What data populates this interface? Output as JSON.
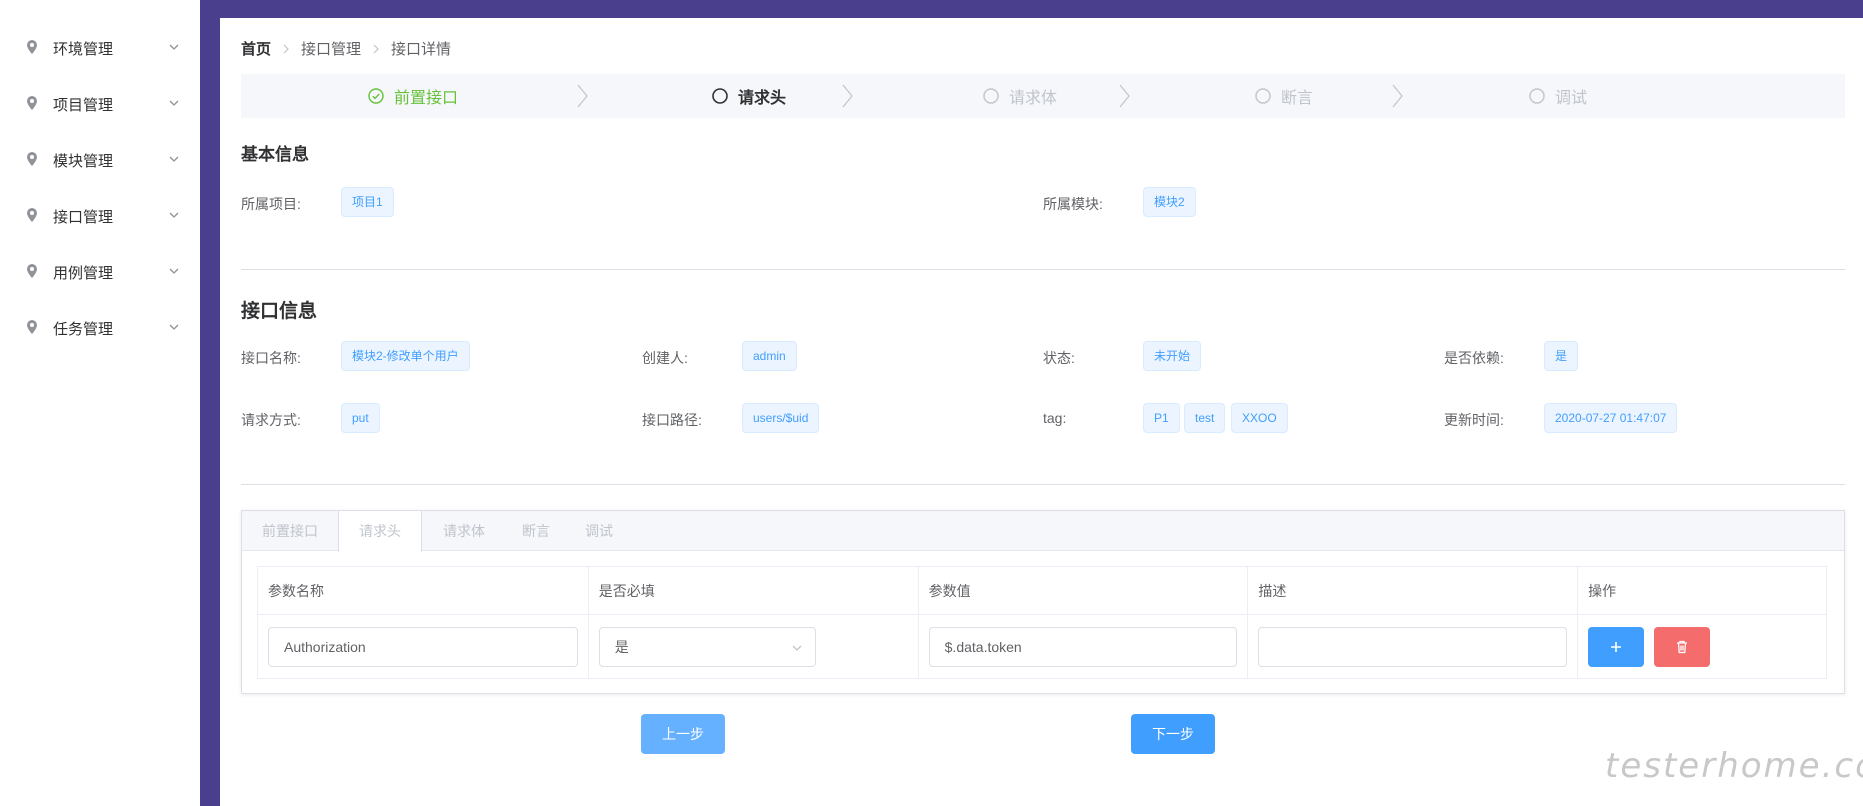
{
  "sidebar": {
    "items": [
      {
        "label": "环境管理"
      },
      {
        "label": "项目管理"
      },
      {
        "label": "模块管理"
      },
      {
        "label": "接口管理"
      },
      {
        "label": "用例管理"
      },
      {
        "label": "任务管理"
      }
    ]
  },
  "breadcrumb": {
    "home": "首页",
    "level2": "接口管理",
    "level3": "接口详情"
  },
  "steps": [
    {
      "label": "前置接口",
      "status": "done"
    },
    {
      "label": "请求头",
      "status": "active"
    },
    {
      "label": "请求体",
      "status": "wait"
    },
    {
      "label": "断言",
      "status": "wait"
    },
    {
      "label": "调试",
      "status": "wait"
    }
  ],
  "basic_info": {
    "title": "基本信息",
    "project_label": "所属项目:",
    "project_value": "项目1",
    "module_label": "所属模块:",
    "module_value": "模块2"
  },
  "api_info": {
    "title": "接口信息",
    "name_label": "接口名称:",
    "name_value": "模块2-修改单个用户",
    "creator_label": "创建人:",
    "creator_value": "admin",
    "status_label": "状态:",
    "status_value": "未开始",
    "depend_label": "是否依赖:",
    "depend_value": "是",
    "method_label": "请求方式:",
    "method_value": "put",
    "path_label": "接口路径:",
    "path_value": "users/$uid",
    "tag_label": "tag:",
    "tags": [
      "P1",
      "test",
      "XXOO"
    ],
    "updated_label": "更新时间:",
    "updated_value": "2020-07-27 01:47:07"
  },
  "tabs": [
    "前置接口",
    "请求头",
    "请求体",
    "断言",
    "调试"
  ],
  "params_table": {
    "headers": [
      "参数名称",
      "是否必填",
      "参数值",
      "描述",
      "操作"
    ],
    "row": {
      "name": "Authorization",
      "required": "是",
      "value": "$.data.token",
      "description": ""
    }
  },
  "buttons": {
    "prev": "上一步",
    "next": "下一步"
  },
  "watermark": "testerhome.com",
  "colors": {
    "frame": "#4a3f8c",
    "primary": "#409eff",
    "success": "#67c23a",
    "danger": "#f56c6c"
  }
}
